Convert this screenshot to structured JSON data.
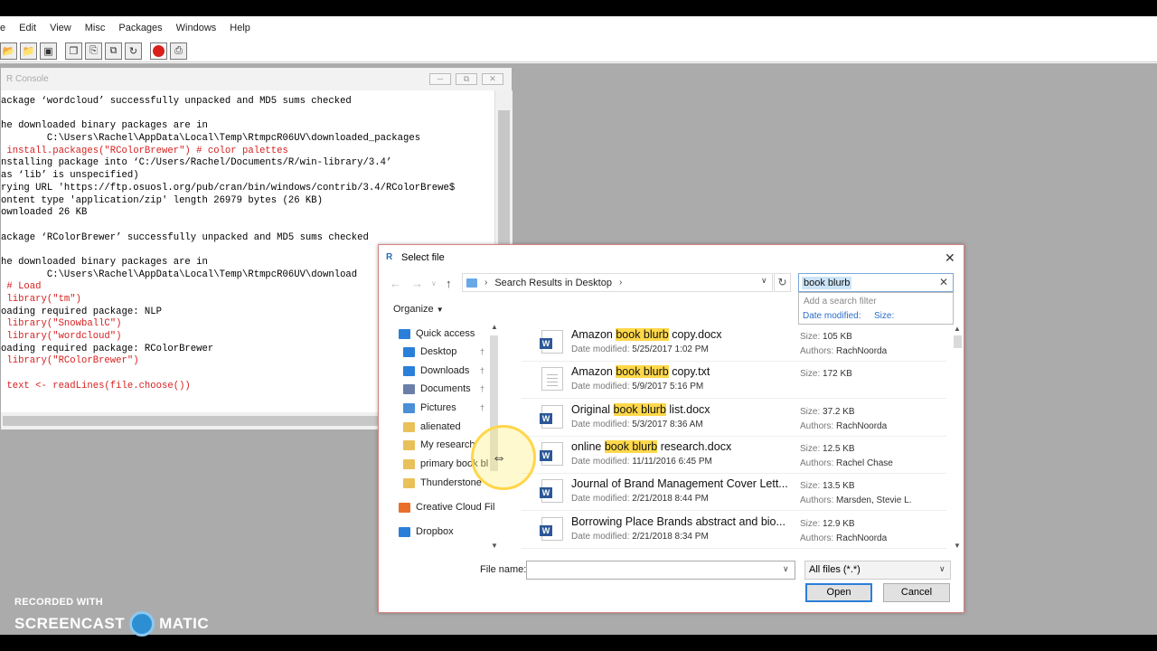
{
  "menu": [
    "e",
    "Edit",
    "View",
    "Misc",
    "Packages",
    "Windows",
    "Help"
  ],
  "console": {
    "title": "R Console",
    "lines": [
      {
        "text": "ackage ‘wordcloud’ successfully unpacked and MD5 sums checked",
        "input": false
      },
      {
        "text": "",
        "input": false
      },
      {
        "text": "he downloaded binary packages are in",
        "input": false
      },
      {
        "text": "        C:\\Users\\Rachel\\AppData\\Local\\Temp\\RtmpcR06UV\\downloaded_packages",
        "input": false
      },
      {
        "text": " install.packages(\"RColorBrewer\") # color palettes",
        "input": true
      },
      {
        "text": "nstalling package into ‘C:/Users/Rachel/Documents/R/win-library/3.4’",
        "input": false
      },
      {
        "text": "as ‘lib’ is unspecified)",
        "input": false
      },
      {
        "text": "rying URL 'https://ftp.osuosl.org/pub/cran/bin/windows/contrib/3.4/RColorBrewe$",
        "input": false
      },
      {
        "text": "ontent type 'application/zip' length 26979 bytes (26 KB)",
        "input": false
      },
      {
        "text": "ownloaded 26 KB",
        "input": false
      },
      {
        "text": "",
        "input": false
      },
      {
        "text": "ackage ‘RColorBrewer’ successfully unpacked and MD5 sums checked",
        "input": false
      },
      {
        "text": "",
        "input": false
      },
      {
        "text": "he downloaded binary packages are in",
        "input": false
      },
      {
        "text": "        C:\\Users\\Rachel\\AppData\\Local\\Temp\\RtmpcR06UV\\download",
        "input": false
      },
      {
        "text": " # Load",
        "input": true
      },
      {
        "text": " library(\"tm\")",
        "input": true
      },
      {
        "text": "oading required package: NLP",
        "input": false
      },
      {
        "text": " library(\"SnowballC\")",
        "input": true
      },
      {
        "text": " library(\"wordcloud\")",
        "input": true
      },
      {
        "text": "oading required package: RColorBrewer",
        "input": false
      },
      {
        "text": " library(\"RColorBrewer\")",
        "input": true
      },
      {
        "text": "",
        "input": false
      },
      {
        "text": " text <- readLines(file.choose())",
        "input": true
      }
    ]
  },
  "dialog": {
    "title": "Select file",
    "address": "Search Results in Desktop",
    "search_value": "book blurb",
    "filter_hint": "Add a search filter",
    "filter_date": "Date modified:",
    "filter_size": "Size:",
    "organize": "Organize",
    "nav_items": [
      {
        "label": "Quick access",
        "icon": "star-icon",
        "color": "#2a7fd8",
        "pinned": false
      },
      {
        "label": "Desktop",
        "icon": "desktop-icon",
        "color": "#2a7fd8",
        "pinned": true
      },
      {
        "label": "Downloads",
        "icon": "download-icon",
        "color": "#2a7fd8",
        "pinned": true
      },
      {
        "label": "Documents",
        "icon": "documents-icon",
        "color": "#6a7fa8",
        "pinned": true
      },
      {
        "label": "Pictures",
        "icon": "pictures-icon",
        "color": "#4a8fd8",
        "pinned": true
      },
      {
        "label": "alienated",
        "icon": "folder-icon",
        "color": "#e8c15a",
        "pinned": false
      },
      {
        "label": "My research",
        "icon": "folder-icon",
        "color": "#e8c15a",
        "pinned": false
      },
      {
        "label": "primary book bl",
        "icon": "folder-icon",
        "color": "#e8c15a",
        "pinned": false
      },
      {
        "label": "Thunderstone",
        "icon": "folder-icon",
        "color": "#e8c15a",
        "pinned": false
      },
      {
        "label": "Creative Cloud Fil",
        "icon": "creative-cloud-icon",
        "color": "#e8702a",
        "pinned": false
      },
      {
        "label": "Dropbox",
        "icon": "dropbox-icon",
        "color": "#2a7fd8",
        "pinned": false
      }
    ],
    "files": [
      {
        "pre": "Amazon ",
        "hl": "book blurb",
        "post": " copy.docx",
        "date": "5/25/2017 1:02 PM",
        "size": "105 KB",
        "author": "RachNoorda",
        "icon": "word-doc-icon"
      },
      {
        "pre": "Amazon ",
        "hl": "book blurb",
        "post": " copy.txt",
        "date": "5/9/2017 5:16 PM",
        "size": "172 KB",
        "author": "",
        "icon": "text-file-icon"
      },
      {
        "pre": "Original ",
        "hl": "book blurb",
        "post": " list.docx",
        "date": "5/3/2017 8:36 AM",
        "size": "37.2 KB",
        "author": "RachNoorda",
        "icon": "word-doc-icon"
      },
      {
        "pre": "online ",
        "hl": "book blurb",
        "post": " research.docx",
        "date": "11/11/2016 6:45 PM",
        "size": "12.5 KB",
        "author": "Rachel Chase",
        "icon": "word-doc-icon"
      },
      {
        "pre": "Journal of Brand Management Cover Lett...",
        "hl": "",
        "post": "",
        "date": "2/21/2018 8:44 PM",
        "size": "13.5 KB",
        "author": "Marsden, Stevie L.",
        "icon": "word-doc-icon"
      },
      {
        "pre": "Borrowing Place Brands abstract and bio...",
        "hl": "",
        "post": "",
        "date": "2/21/2018 8:34 PM",
        "size": "12.9 KB",
        "author": "RachNoorda",
        "icon": "word-doc-icon"
      }
    ],
    "date_label": "Date modified:",
    "size_label": "Size:",
    "authors_label": "Authors:",
    "filename_label": "File name:",
    "filename_value": "",
    "filetype": "All files (*.*)",
    "open_label": "Open",
    "cancel_label": "Cancel"
  },
  "watermark": {
    "recorded": "RECORDED WITH",
    "brand_left": "SCREENCAST",
    "brand_right": "MATIC"
  }
}
